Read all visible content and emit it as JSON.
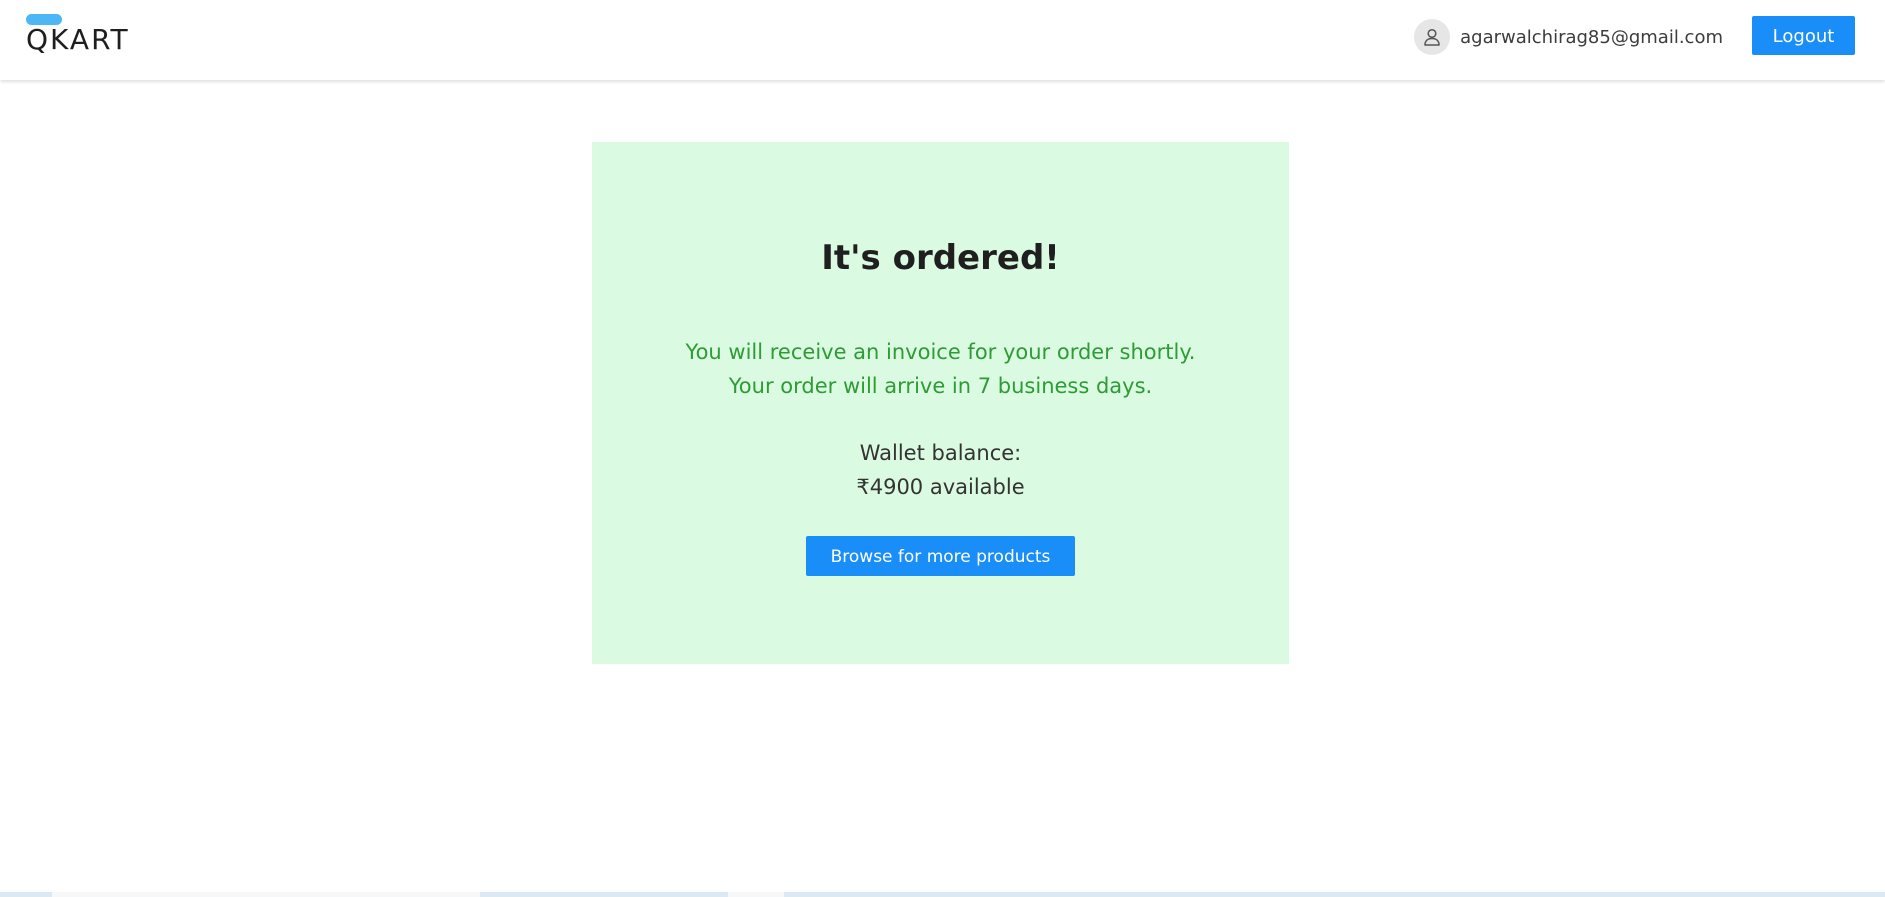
{
  "header": {
    "logo_text": "QKART",
    "user_email": "agarwalchirag85@gmail.com",
    "logout_label": "Logout"
  },
  "order": {
    "title": "It's ordered!",
    "message_line1": "You will receive an invoice for your order shortly.",
    "message_line2": "Your order will arrive in 7 business days.",
    "wallet_label": "Wallet balance:",
    "wallet_value": "₹4900 available",
    "browse_label": "Browse for more products"
  },
  "colors": {
    "accent": "#1a8ef8",
    "logo_bar": "#4db6f5",
    "card_bg": "#dafbe2",
    "message_green": "#2e9b34"
  },
  "icons": {
    "avatar": "user-avatar-icon"
  }
}
